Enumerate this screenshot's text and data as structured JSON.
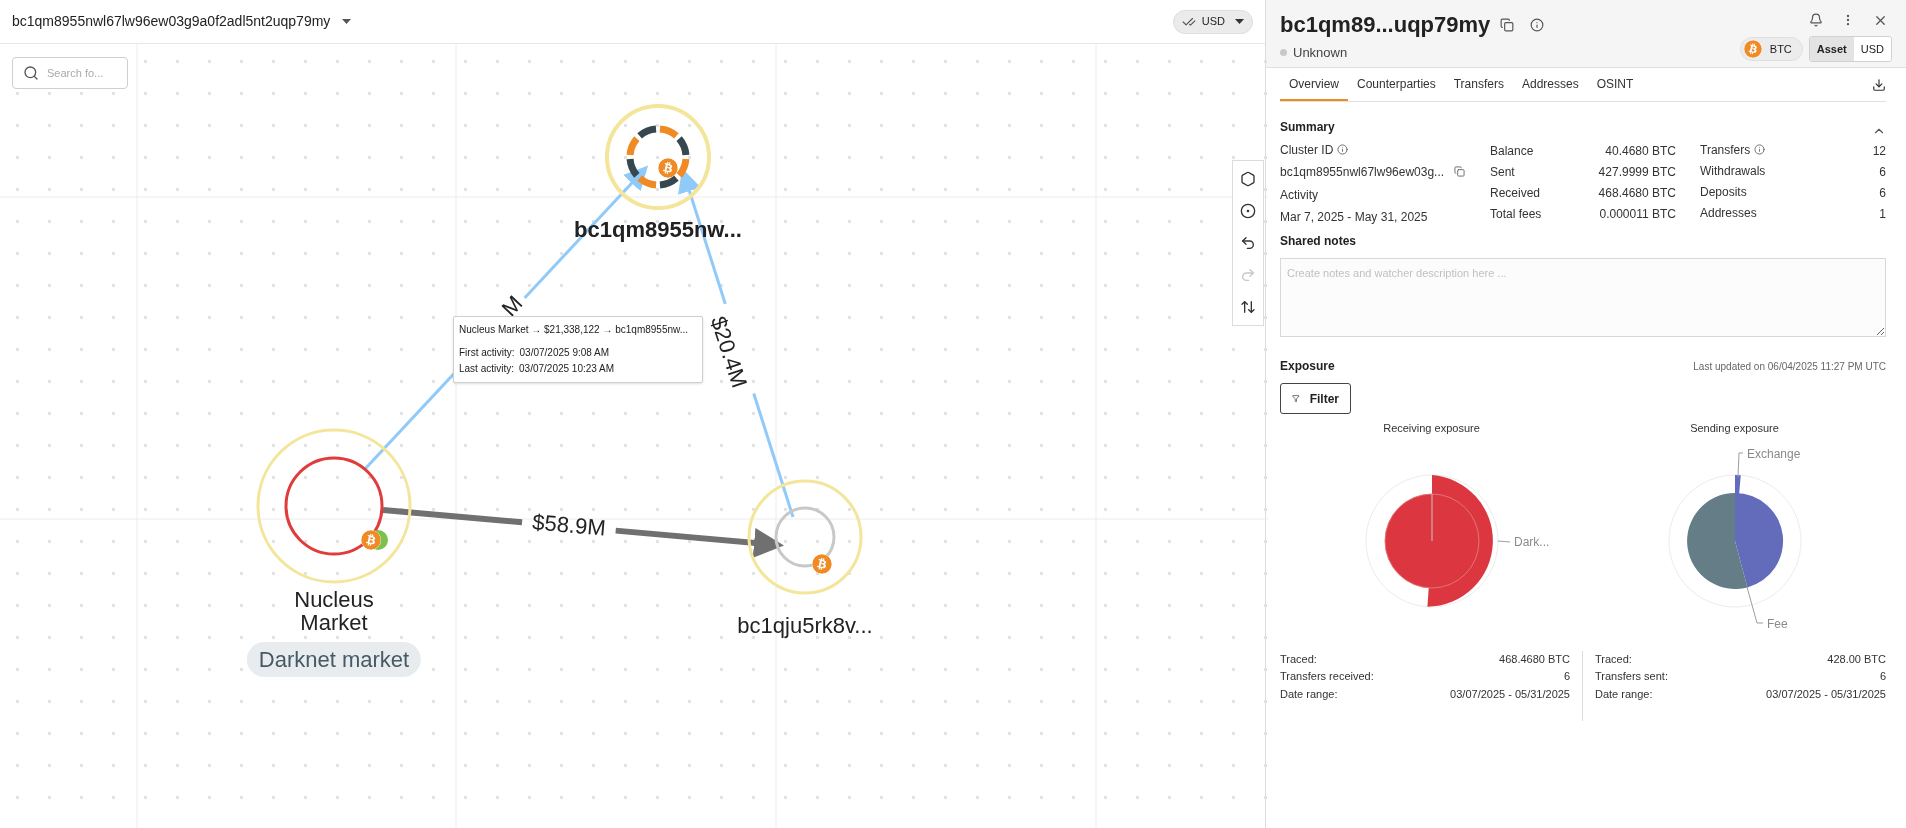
{
  "topbar": {
    "title": "bc1qm8955nwl67lw96ew03g9a0f2adl5nt2uqp79my",
    "currency": "USD"
  },
  "search": {
    "placeholder": "Search fo..."
  },
  "toolbar": [
    {
      "kind": "hexagon",
      "disabled": false
    },
    {
      "kind": "target",
      "disabled": false
    },
    {
      "kind": "undo",
      "disabled": false
    },
    {
      "kind": "redo",
      "disabled": true
    },
    {
      "kind": "swap",
      "disabled": false
    }
  ],
  "graph": {
    "nodes": [
      {
        "kind": "cluster",
        "label": "bc1qm8955nw..."
      },
      {
        "kind": "entity",
        "label": "Nucleus Market",
        "tag": "Darknet market"
      },
      {
        "kind": "address",
        "label": "bc1qju5rk8v..."
      }
    ],
    "edges": [
      {
        "kind": "incoming",
        "label": "M"
      },
      {
        "kind": "incoming",
        "label": "$20.4M"
      },
      {
        "kind": "outgoing",
        "label": "$58.9M"
      }
    ],
    "tooltip": {
      "route": "Nucleus Market → $21,338,122 → bc1qm8955nw...",
      "rows": [
        {
          "label": "First activity:",
          "value": "03/07/2025 9:08 AM"
        },
        {
          "label": "Last activity:",
          "value": "03/07/2025 10:23 AM"
        }
      ]
    }
  },
  "panel": {
    "title": "bc1qm89...uqp79my",
    "status": "Unknown",
    "asset": "BTC",
    "units": [
      {
        "label": "Asset",
        "selected": true
      },
      {
        "label": "USD",
        "selected": false
      }
    ],
    "tabs": [
      {
        "label": "Overview",
        "selected": true
      },
      {
        "label": "Counterparties",
        "selected": false
      },
      {
        "label": "Transfers",
        "selected": false
      },
      {
        "label": "Addresses",
        "selected": false
      },
      {
        "label": "OSINT",
        "selected": false
      }
    ],
    "summary": {
      "title": "Summary",
      "expanded": true,
      "cluster_label": "Cluster ID",
      "cluster_id": "bc1qm8955nwl67lw96ew03g...",
      "activity_label": "Activity",
      "activity": "Mar 7, 2025 - May 31, 2025",
      "balances": [
        {
          "label": "Balance",
          "value": "40.4680 BTC"
        },
        {
          "label": "Sent",
          "value": "427.9999 BTC"
        },
        {
          "label": "Received",
          "value": "468.4680 BTC"
        },
        {
          "label": "Total fees",
          "value": "0.000011 BTC"
        }
      ],
      "counts": [
        {
          "label": "Transfers",
          "value": "12",
          "info": true
        },
        {
          "label": "Withdrawals",
          "value": "6",
          "info": false
        },
        {
          "label": "Deposits",
          "value": "6",
          "info": false
        },
        {
          "label": "Addresses",
          "value": "1",
          "info": false
        }
      ]
    },
    "notes": {
      "title": "Shared notes",
      "placeholder": "Create notes and watcher description here ..."
    },
    "exposure": {
      "title": "Exposure",
      "updated": "Last updated on 06/04/2025 11:27 PM UTC",
      "filter": "Filter",
      "charts": [
        {
          "kind": "receiving",
          "title": "Receiving exposure",
          "callouts": [
            "Dark..."
          ],
          "stats": [
            {
              "label": "Traced:",
              "value": "468.4680 BTC"
            },
            {
              "label": "Transfers received:",
              "value": "6"
            },
            {
              "label": "Date range:",
              "value": "03/07/2025 - 05/31/2025"
            }
          ]
        },
        {
          "kind": "sending",
          "title": "Sending exposure",
          "callouts": [
            "Exchange",
            "Fee"
          ],
          "stats": [
            {
              "label": "Traced:",
              "value": "428.00 BTC"
            },
            {
              "label": "Transfers sent:",
              "value": "6"
            },
            {
              "label": "Date range:",
              "value": "03/07/2025 - 05/31/2025"
            }
          ]
        }
      ]
    }
  }
}
